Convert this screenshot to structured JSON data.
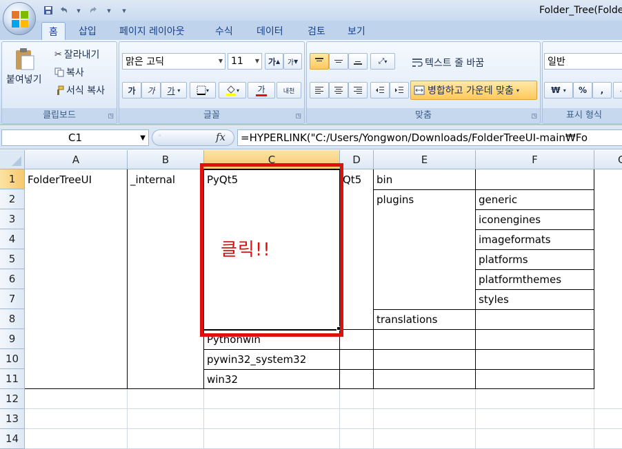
{
  "window": {
    "title": "Folder_Tree(Folder"
  },
  "tabs": [
    "홈",
    "삽입",
    "페이지 레이아웃",
    "수식",
    "데이터",
    "검토",
    "보기"
  ],
  "clipboard": {
    "paste": "붙여넣기",
    "cut": "잘라내기",
    "copy": "복사",
    "format_painter": "서식 복사",
    "label": "클립보드"
  },
  "font": {
    "name": "맑은 고딕",
    "size": "11",
    "grow": "가",
    "shrink": "가",
    "bold": "가",
    "italic": "가",
    "underline": "가",
    "font_color_letter": "가",
    "phonetic": "내천",
    "label": "글꼴"
  },
  "alignment": {
    "wrap_text": "텍스트 줄 바꿈",
    "merge_center": "병합하고 가운데 맞춤",
    "label": "맞춤"
  },
  "number": {
    "format": "일반",
    "currency": "₩",
    "percent": "%",
    "comma": ",",
    "label": "표시 형식"
  },
  "formula_bar": {
    "name_box": "C1",
    "fx": "fx",
    "formula": "=HYPERLINK(\"C:/Users/Yongwon/Downloads/FolderTreeUI-main₩Fo"
  },
  "columns": [
    "A",
    "B",
    "C",
    "D",
    "E",
    "F",
    "G"
  ],
  "rows": [
    "1",
    "2",
    "3",
    "4",
    "5",
    "6",
    "7",
    "8",
    "9",
    "10",
    "11",
    "12",
    "13",
    "14"
  ],
  "cells": {
    "A1": "FolderTreeUI",
    "B1": "_internal",
    "C1": "PyQt5",
    "D1": "Qt5",
    "E1": "bin",
    "E2": "plugins",
    "F2": "generic",
    "F3": "iconengines",
    "F4": "imageformats",
    "F5": "platforms",
    "F6": "platformthemes",
    "F7": "styles",
    "E8": "translations",
    "C9": "Pythonwin",
    "C10": "pywin32_system32",
    "C11": "win32"
  },
  "annotation": {
    "text": "클릭!!",
    "color": "#e01010"
  },
  "colors": {
    "ribbon_bg": "#d7e4f4",
    "selected_header": "#f7c96e",
    "callout_red": "#e01010"
  }
}
